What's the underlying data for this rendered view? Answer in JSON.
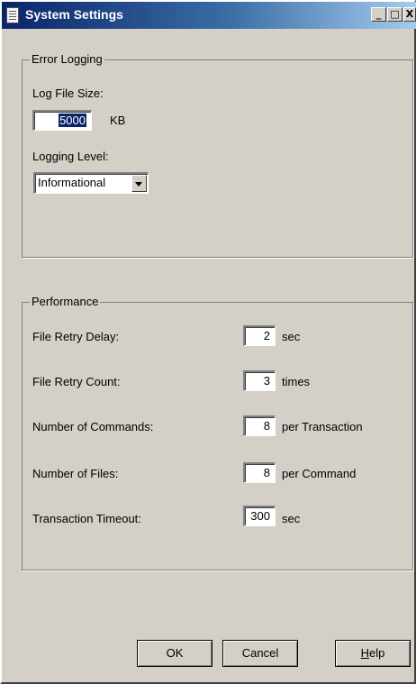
{
  "window": {
    "title": "System Settings",
    "controls": {
      "minimize": "_",
      "maximize": "□",
      "close": "X"
    }
  },
  "error_logging": {
    "legend": "Error Logging",
    "log_file_size_label": "Log File Size:",
    "log_file_size_value": "5000",
    "log_file_size_unit": "KB",
    "logging_level_label": "Logging Level:",
    "logging_level_value": "Informational"
  },
  "performance": {
    "legend": "Performance",
    "rows": [
      {
        "label": "File Retry Delay:",
        "value": "2",
        "unit": "sec"
      },
      {
        "label": "File Retry Count:",
        "value": "3",
        "unit": "times"
      },
      {
        "label": "Number of Commands:",
        "value": "8",
        "unit": "per Transaction"
      },
      {
        "label": "Number of Files:",
        "value": "8",
        "unit": "per Command"
      },
      {
        "label": "Transaction Timeout:",
        "value": "300",
        "unit": "sec"
      }
    ]
  },
  "buttons": {
    "ok": "OK",
    "cancel": "Cancel",
    "help_mnemonic": "H",
    "help_rest": "elp"
  },
  "icons": [
    "window-icon",
    "minimize-icon",
    "maximize-icon",
    "close-icon",
    "dropdown-arrow-icon"
  ]
}
